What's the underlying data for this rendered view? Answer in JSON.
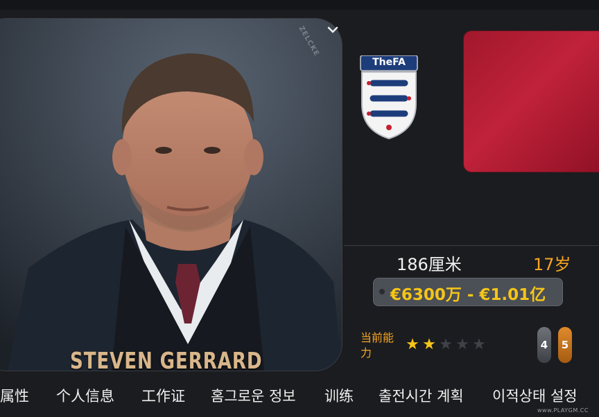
{
  "player": {
    "name": "STEVEN GERRARD",
    "photo_brand": "ZELCKE"
  },
  "club": {
    "badge_text": "TheFA",
    "flag_color": "#b01c33"
  },
  "stats": {
    "height": "186厘米",
    "age": "17岁",
    "value_range": "€6300万 - €1.01亿",
    "potential_label": "当前能力",
    "stars_filled": 2,
    "stars_total": 5,
    "rating_current": "4",
    "rating_potential": "5"
  },
  "tabs": [
    {
      "label": "属性"
    },
    {
      "label": "个人信息"
    },
    {
      "label": "工作证"
    },
    {
      "label": "홈그로운 정보"
    },
    {
      "label": "训练"
    },
    {
      "label": "출전시간 계획"
    },
    {
      "label": "이적상태 설정"
    }
  ],
  "watermark": {
    "site": "www.PLAYGM.CC"
  },
  "icons": {
    "expand": "chevron-down-icon"
  },
  "colors": {
    "accent": "#f5a623",
    "value": "#f5c518",
    "background": "#1b1c1f"
  }
}
